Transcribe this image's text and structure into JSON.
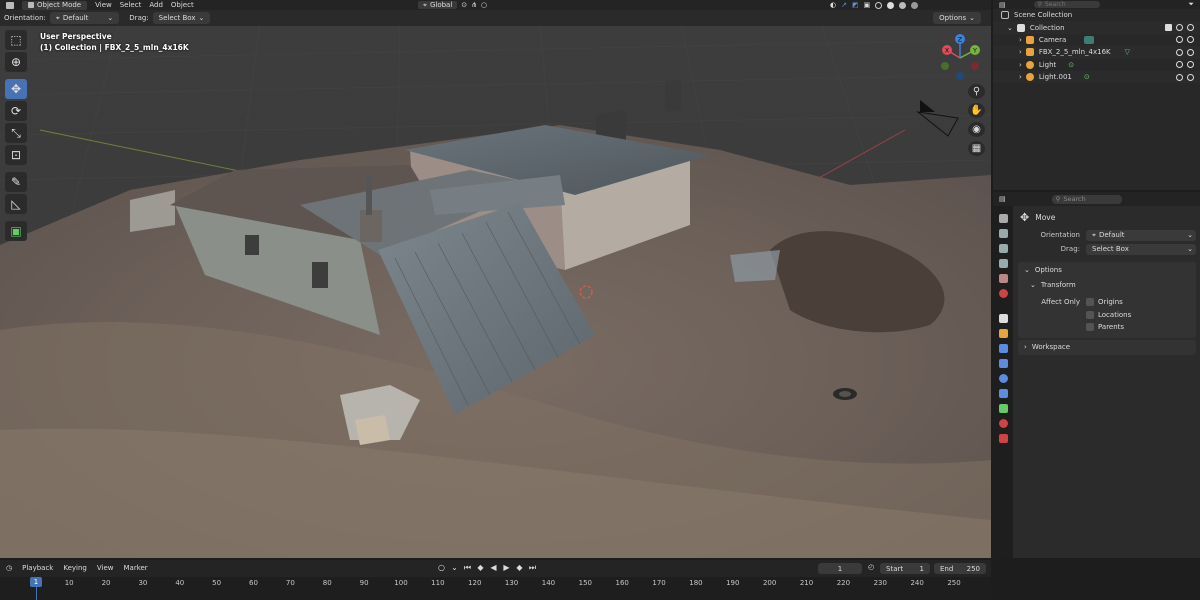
{
  "viewport_header": {
    "mode": "Object Mode",
    "menus": [
      "View",
      "Select",
      "Add",
      "Object"
    ],
    "transform_orientation": "Global"
  },
  "tool_header": {
    "orientation_label": "Orientation:",
    "orientation_value": "Default",
    "drag_label": "Drag:",
    "drag_value": "Select Box",
    "options_label": "Options"
  },
  "viewport_overlay": {
    "view_name": "User Perspective",
    "collection_info": "(1) Collection | FBX_2_5_mln_4x16K"
  },
  "gizmo": {
    "z": "Z",
    "y": "Y",
    "x": "X"
  },
  "outliner": {
    "search_placeholder": "Search",
    "scene_collection": "Scene Collection",
    "collection": "Collection",
    "items": [
      {
        "name": "Camera",
        "icon": "camera-icon",
        "color": "#e8a33d"
      },
      {
        "name": "FBX_2_5_mln_4x16K",
        "icon": "mesh-icon",
        "color": "#e8a33d"
      },
      {
        "name": "Light",
        "icon": "light-icon",
        "color": "#e8a33d"
      },
      {
        "name": "Light.001",
        "icon": "light-icon",
        "color": "#e8a33d"
      }
    ]
  },
  "properties": {
    "search_placeholder": "Search",
    "tool_name": "Move",
    "orientation_label": "Orientation",
    "orientation_value": "Default",
    "drag_label": "Drag:",
    "drag_value": "Select Box",
    "options_panel": "Options",
    "transform_panel": "Transform",
    "affect_only_label": "Affect Only",
    "affect_options": [
      "Origins",
      "Locations",
      "Parents"
    ],
    "workspace_panel": "Workspace"
  },
  "timeline": {
    "menus": [
      "Playback",
      "Keying",
      "View",
      "Marker"
    ],
    "current_frame": "1",
    "start_label": "Start",
    "start_value": "1",
    "end_label": "End",
    "end_value": "250",
    "ruler_ticks": [
      "10",
      "20",
      "30",
      "40",
      "50",
      "60",
      "70",
      "80",
      "90",
      "100",
      "110",
      "120",
      "130",
      "140",
      "150",
      "160",
      "170",
      "180",
      "190",
      "200",
      "210",
      "220",
      "230",
      "240",
      "250"
    ],
    "cursor_frame": "1"
  },
  "colors": {
    "accent": "#4772b3",
    "object_orange": "#e8a33d",
    "mesh_green": "#66cc66",
    "axis_x": "#e04a5b",
    "axis_y": "#76b340",
    "axis_z": "#3b82d9"
  }
}
